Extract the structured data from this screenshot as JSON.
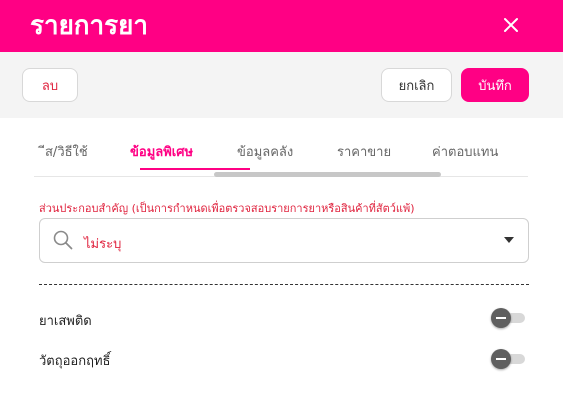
{
  "header": {
    "title": "รายการยา",
    "close_icon": "close-icon"
  },
  "toolbar": {
    "delete_label": "ลบ",
    "cancel_label": "ยกเลิก",
    "save_label": "บันทึก"
  },
  "tabs": [
    {
      "label": "ีส/วิธีใช้",
      "active": false
    },
    {
      "label": "ข้อมูลพิเศษ",
      "active": true
    },
    {
      "label": "ข้อมูลคลัง",
      "active": false
    },
    {
      "label": "ราคาขาย",
      "active": false
    },
    {
      "label": "ค่าตอบแทน",
      "active": false
    }
  ],
  "ingredient": {
    "label": "ส่วนประกอบสำคัญ (เป็นการกำหนดเพื่อตรวจสอบรายการยาหรือสินค้าที่สัตว์แพ้)",
    "value": "ไม่ระบุ",
    "search_icon": "search-icon",
    "caret_icon": "caret-down-icon"
  },
  "flags": [
    {
      "label": "ยาเสพติด",
      "on": false
    },
    {
      "label": "วัตถุออกฤทธิ์",
      "on": false
    }
  ],
  "colors": {
    "brand": "#ff0084",
    "danger": "#e0243f"
  }
}
